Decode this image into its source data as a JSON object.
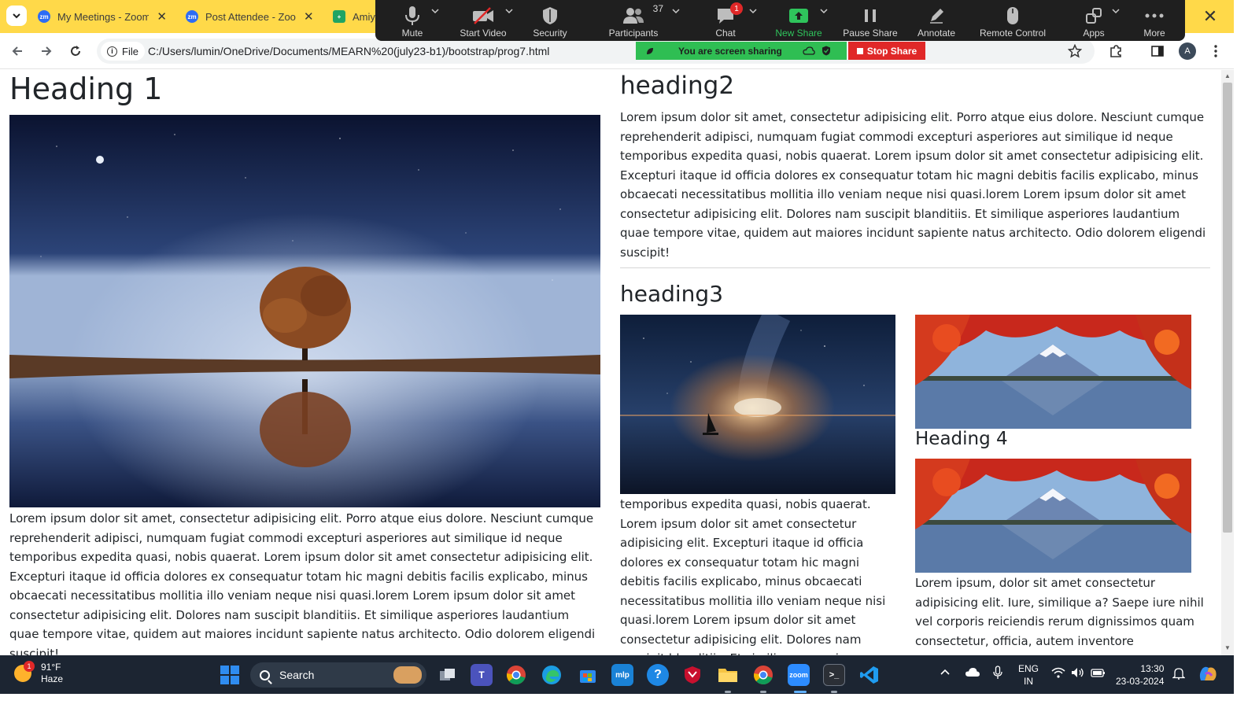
{
  "browser": {
    "tabs": [
      {
        "label": "My Meetings - Zoom",
        "favicon": "zm"
      },
      {
        "label": "Post Attendee - Zoom",
        "favicon": "zm"
      },
      {
        "label": "Amiya",
        "favicon": "+"
      }
    ],
    "url_chip": "File",
    "url": "C:/Users/lumin/OneDrive/Documents/MEARN%20(july23-b1)/bootstrap/prog7.html",
    "avatar_letter": "A"
  },
  "zoom_toolbar": {
    "items": [
      {
        "label": "Mute",
        "icon": "microphone-icon"
      },
      {
        "label": "Start Video",
        "icon": "video-off-icon"
      },
      {
        "label": "Security",
        "icon": "shield-icon"
      },
      {
        "label": "Participants",
        "icon": "participants-icon",
        "count": "37"
      },
      {
        "label": "Chat",
        "icon": "chat-icon",
        "badge": "1"
      },
      {
        "label": "New Share",
        "icon": "share-screen-icon"
      },
      {
        "label": "Pause Share",
        "icon": "pause-icon"
      },
      {
        "label": "Annotate",
        "icon": "pencil-icon"
      },
      {
        "label": "Remote Control",
        "icon": "mouse-icon"
      },
      {
        "label": "Apps",
        "icon": "apps-icon"
      },
      {
        "label": "More",
        "icon": "more-dots-icon"
      }
    ],
    "sharing_text": "You are screen sharing",
    "stop_share": "Stop Share"
  },
  "page": {
    "heading1": "Heading 1",
    "heading2": "heading2",
    "heading3": "heading3",
    "heading4": "Heading 4",
    "para_left": "Lorem ipsum dolor sit amet, consectetur adipisicing elit. Porro atque eius dolore. Nesciunt cumque reprehenderit adipisci, numquam fugiat commodi excepturi asperiores aut similique id neque temporibus expedita quasi, nobis quaerat. Lorem ipsum dolor sit amet consectetur adipisicing elit. Excepturi itaque id officia dolores ex consequatur totam hic magni debitis facilis explicabo, minus obcaecati necessitatibus mollitia illo veniam neque nisi quasi.lorem Lorem ipsum dolor sit amet consectetur adipisicing elit. Dolores nam suscipit blanditiis. Et similique asperiores laudantium quae tempore vitae, quidem aut maiores incidunt sapiente natus architecto. Odio dolorem eligendi suscipit!",
    "para_right": "Lorem ipsum dolor sit amet, consectetur adipisicing elit. Porro atque eius dolore. Nesciunt cumque reprehenderit adipisci, numquam fugiat commodi excepturi asperiores aut similique id neque temporibus expedita quasi, nobis quaerat. Lorem ipsum dolor sit amet consectetur adipisicing elit. Excepturi itaque id officia dolores ex consequatur totam hic magni debitis facilis explicabo, minus obcaecati necessitatibus mollitia illo veniam neque nisi quasi.lorem Lorem ipsum dolor sit amet consectetur adipisicing elit. Dolores nam suscipit blanditiis. Et similique asperiores laudantium quae tempore vitae, quidem aut maiores incidunt sapiente natus architecto. Odio dolorem eligendi suscipit!",
    "para_h3": "temporibus expedita quasi, nobis quaerat. Lorem ipsum dolor sit amet consectetur adipisicing elit. Excepturi itaque id officia dolores ex consequatur totam hic magni debitis facilis explicabo, minus obcaecati necessitatibus mollitia illo veniam neque nisi quasi.lorem Lorem ipsum dolor sit amet consectetur adipisicing elit. Dolores nam suscipit blanditiis. Et similique asperiores laudantium",
    "para_h4": "Lorem ipsum, dolor sit amet consectetur adipisicing elit. Iure, similique a? Saepe iure nihil vel corporis reiciendis rerum dignissimos quam consectetur, officia, autem inventore"
  },
  "taskbar": {
    "weather_temp": "91°F",
    "weather_desc": "Haze",
    "weather_badge": "1",
    "search_label": "Search",
    "lang_line1": "ENG",
    "lang_line2": "IN",
    "time": "13:30",
    "date": "23-03-2024"
  }
}
